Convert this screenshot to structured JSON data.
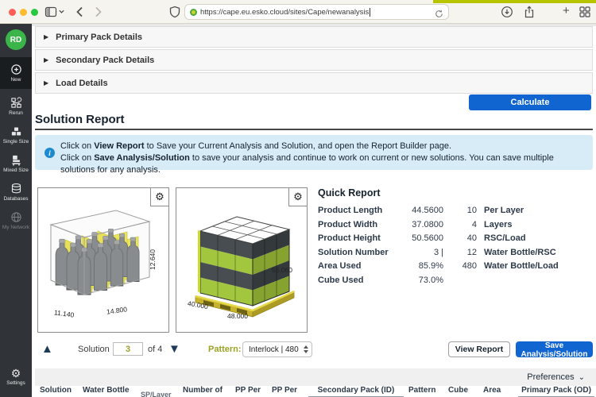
{
  "browser": {
    "url": "https://cape.eu.esko.cloud/sites/Cape/newanalysis"
  },
  "colors": {
    "accent_blue": "#1165d0",
    "brand_lime": "#b9c400",
    "olive_text": "#9ba226",
    "info_bg": "#d8ecf7",
    "avatar_green": "#3bb54a"
  },
  "icons": {
    "gear": "⚙",
    "arrow_right": "▶",
    "caret_up": "▲",
    "caret_down": "▼",
    "chevron_down": "⌄",
    "info_letter": "i",
    "plus": "+"
  },
  "sidebar": {
    "avatar_initials": "RD",
    "items": [
      {
        "label": "New"
      },
      {
        "label": "Rerun"
      },
      {
        "label": "Single Size"
      },
      {
        "label": "Mixed Size"
      },
      {
        "label": "Databases"
      },
      {
        "label": "My Network"
      }
    ],
    "settings_label": "Settings"
  },
  "accordions": [
    {
      "label": "Primary Pack Details"
    },
    {
      "label": "Secondary Pack Details"
    },
    {
      "label": "Load Details"
    }
  ],
  "actions": {
    "calculate": "Calculate",
    "view_report": "View Report",
    "save_analysis": "Save Analysis/Solution"
  },
  "solution_report": {
    "title": "Solution Report",
    "info": {
      "line1_pre": "Click on ",
      "line1_bold": "View Report",
      "line1_post": " to Save your Current Analysis and Solution, and open the Report Builder page.",
      "line2_pre": "Click on ",
      "line2_bold": "Save Analysis/Solution",
      "line2_post": " to save your analysis and continue to work on current or new solutions. You can save multiple solutions for any analysis."
    }
  },
  "viz": {
    "case": {
      "width_label": "11.140",
      "depth_label": "14.800",
      "height_label": "12.640"
    },
    "load": {
      "width_label": "40.000",
      "depth_label": "48.000",
      "height_label": "56.060"
    }
  },
  "quick_report": {
    "title": "Quick Report",
    "rows": [
      {
        "l": "Product Length",
        "v": "44.5600",
        "n": "10",
        "r": "Per Layer"
      },
      {
        "l": "Product Width",
        "v": "37.0800",
        "n": "4",
        "r": "Layers"
      },
      {
        "l": "Product Height",
        "v": "50.5600",
        "n": "40",
        "r": "RSC/Load"
      },
      {
        "l": "Solution Number",
        "v": "3 |",
        "n": "12",
        "r": "Water Bottle/RSC"
      },
      {
        "l": "Area Used",
        "v": "85.9%",
        "n": "480",
        "r": "Water Bottle/Load"
      },
      {
        "l": "Cube Used",
        "v": "73.0%",
        "n": "",
        "r": ""
      }
    ]
  },
  "solution_nav": {
    "label": "Solution",
    "value": "3",
    "total": "of 4"
  },
  "pattern": {
    "label": "Pattern:",
    "selected": "Interlock | 480"
  },
  "preferences": {
    "label": "Preferences"
  },
  "table": {
    "headers": [
      "Solution",
      "Water Bottle",
      "SP/Layer",
      "Number of",
      "PP Per",
      "PP Per",
      "Secondary Pack (ID)",
      "Pattern",
      "Cube",
      "Area",
      "Primary Pack (OD)"
    ]
  }
}
